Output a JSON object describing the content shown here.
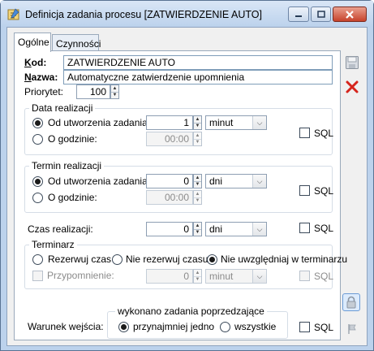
{
  "window": {
    "title": "Definicja zadania procesu [ZATWIERDZENIE AUTO]",
    "controls": {
      "minimize": "minimize-icon",
      "maximize": "maximize-icon",
      "close": "close-icon"
    }
  },
  "tabs": [
    {
      "label": "Ogólne",
      "active": true
    },
    {
      "label": "Czynności",
      "active": false
    }
  ],
  "form": {
    "kod_label": "Kod:",
    "kod_value": "ZATWIERDZENIE AUTO",
    "nazwa_label": "Nazwa:",
    "nazwa_value": "Automatyczne zatwierdzenie upomnienia",
    "priorytet_label": "Priorytet:",
    "priorytet_value": "100"
  },
  "data_realizacji": {
    "title": "Data realizacji",
    "opt1_label": "Od utworzenia zadania:",
    "opt1_selected": true,
    "opt1_value": "1",
    "opt1_unit": "minut",
    "opt2_label": "O godzinie:",
    "opt2_value": "00:00",
    "sql_label": "SQL"
  },
  "termin_realizacji": {
    "title": "Termin realizacji",
    "opt1_label": "Od utworzenia zadania:",
    "opt1_selected": true,
    "opt1_value": "0",
    "opt1_unit": "dni",
    "opt2_label": "O godzinie:",
    "opt2_value": "00:00",
    "sql_label": "SQL"
  },
  "czas_realizacji": {
    "label": "Czas realizacji:",
    "value": "0",
    "unit": "dni",
    "sql_label": "SQL"
  },
  "terminarz": {
    "title": "Terminarz",
    "opt1_label": "Rezerwuj czas",
    "opt2_label": "Nie rezerwuj czasu",
    "opt3_label": "Nie uwzględniaj w terminarzu",
    "selected": "opt3",
    "przypomnienie_label": "Przypomnienie:",
    "przypomnienie_value": "0",
    "przypomnienie_unit": "minut",
    "sql_label": "SQL"
  },
  "warunek": {
    "label": "Warunek wejścia:",
    "group_title": "wykonano zadania poprzedzające",
    "opt1_label": "przynajmniej jedno",
    "opt2_label": "wszystkie",
    "selected": "opt1",
    "sql_label": "SQL"
  },
  "sidebar": {
    "save": "save-icon",
    "cancel": "cancel-icon",
    "lock": "lock-icon",
    "flag": "flag-icon"
  }
}
